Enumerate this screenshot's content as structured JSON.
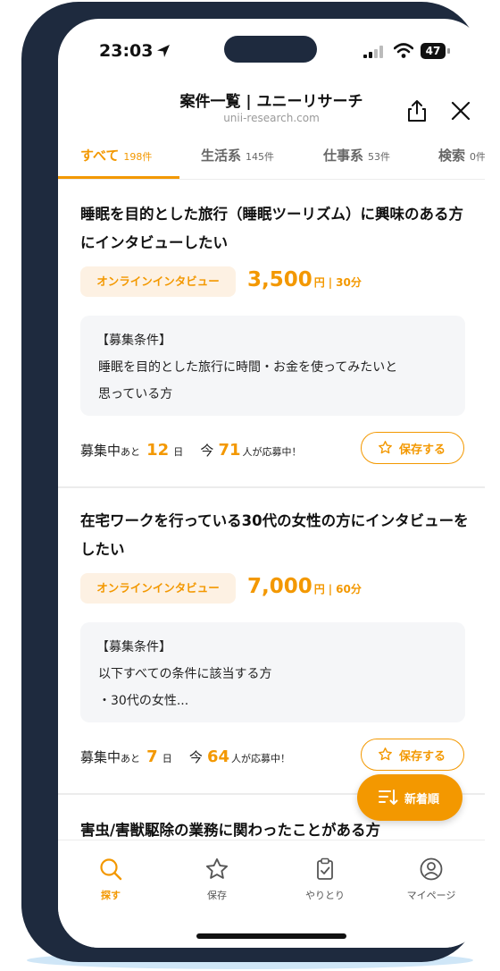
{
  "status_bar": {
    "time": "23:03",
    "battery": "47"
  },
  "header": {
    "title": "案件一覧 | ユニーリサーチ",
    "url": "unii-research.com"
  },
  "tabs": [
    {
      "label": "すべて",
      "count": "198件"
    },
    {
      "label": "生活系",
      "count": "145件"
    },
    {
      "label": "仕事系",
      "count": "53件"
    },
    {
      "label": "検索",
      "count": "0件"
    }
  ],
  "cards": [
    {
      "title": "睡眠を目的とした旅行（睡眠ツーリズム）に興味のある方にインタビューしたい",
      "badge": "オンラインインタビュー",
      "price": "3,500",
      "price_unit": "円",
      "separator": "|",
      "duration": "30分",
      "conditions_heading": "【募集条件】",
      "conditions": [
        "睡眠を目的とした旅行に時間・お金を使ってみたいと",
        "思っている方"
      ],
      "recruiting": "募集中",
      "remaining_prefix": "あと",
      "remaining_days": "12",
      "remaining_unit": "日",
      "today_label": "今",
      "applicants": "71",
      "applicants_suffix": "人が応募中！",
      "save_label": "保存する"
    },
    {
      "title": "在宅ワークを行っている30代の女性の方にインタビューをしたい",
      "badge": "オンラインインタビュー",
      "price": "7,000",
      "price_unit": "円",
      "separator": "|",
      "duration": "60分",
      "conditions_heading": "【募集条件】",
      "conditions": [
        "以下すべての条件に該当する方",
        "・30代の女性..."
      ],
      "recruiting": "募集中",
      "remaining_prefix": "あと",
      "remaining_days": "7",
      "remaining_unit": "日",
      "today_label": "今",
      "applicants": "64",
      "applicants_suffix": "人が応募中！",
      "save_label": "保存する"
    },
    {
      "title": "害虫/害獣駆除の業務に関わったことがある方"
    }
  ],
  "sort_button": {
    "label": "新着順",
    "icon": "sort-icon"
  },
  "bottom_nav": [
    {
      "label": "探す",
      "icon": "search-icon",
      "active": true
    },
    {
      "label": "保存",
      "icon": "star-icon",
      "active": false
    },
    {
      "label": "やりとり",
      "icon": "clipboard-check-icon",
      "active": false
    },
    {
      "label": "マイページ",
      "icon": "user-icon",
      "active": false
    }
  ],
  "colors": {
    "accent": "#f39800",
    "frame": "#1e2a3e"
  }
}
